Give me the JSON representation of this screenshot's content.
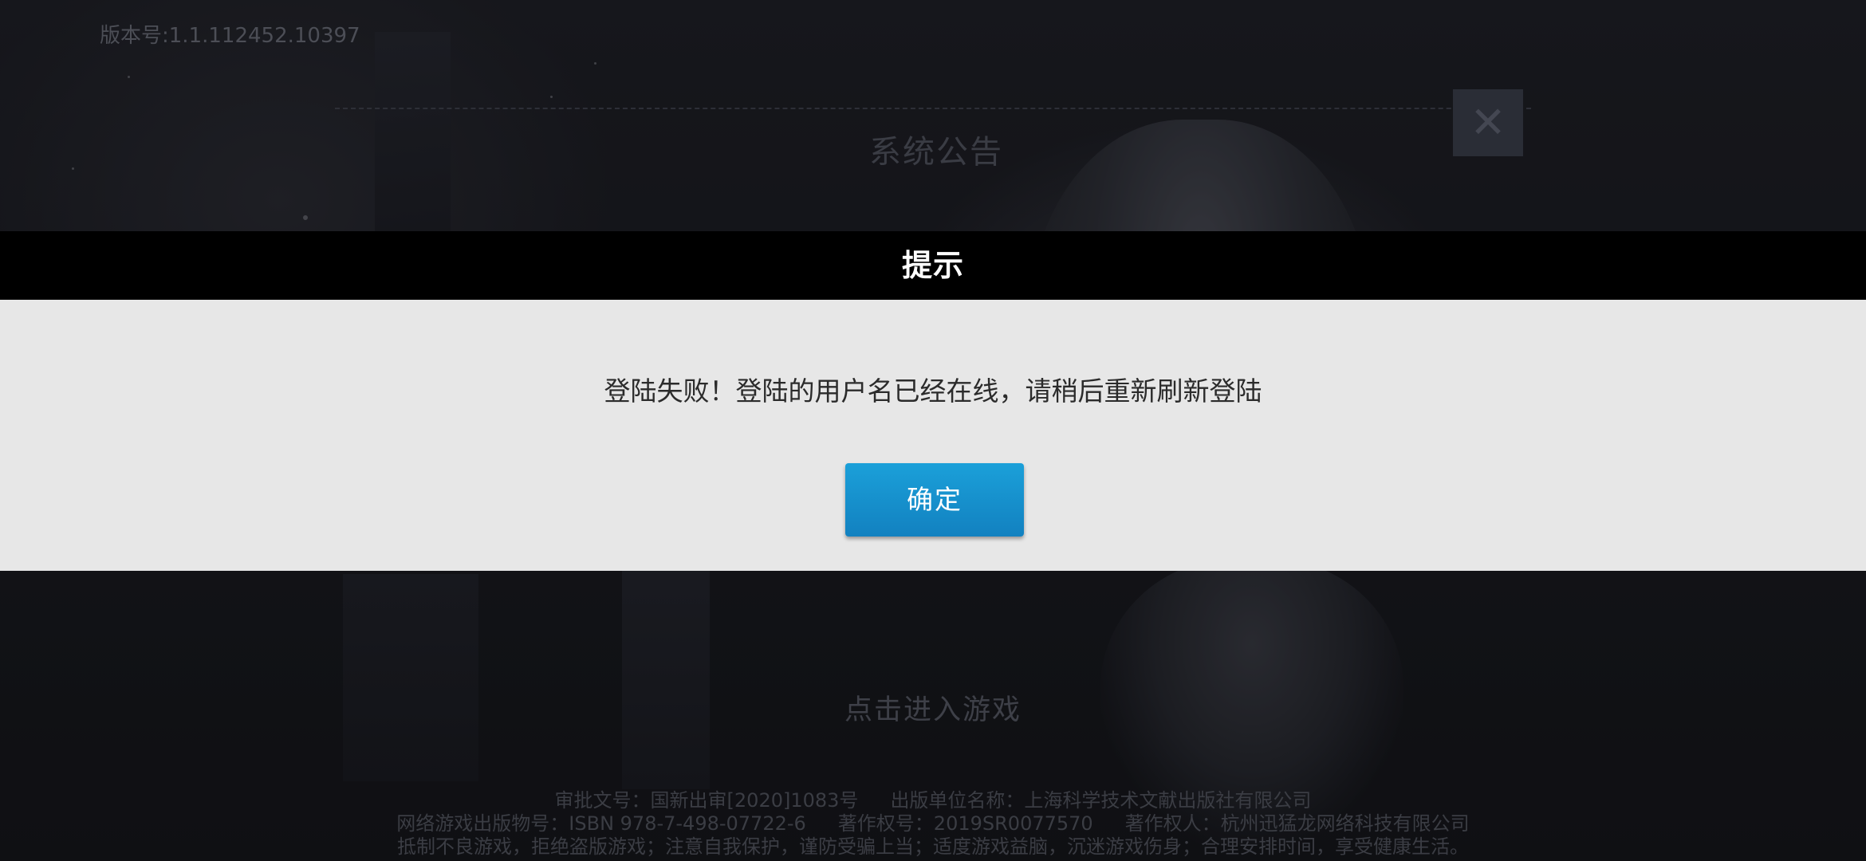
{
  "background": {
    "version_text": "版本号:1.1.112452.10397",
    "notice_title": "系统公告",
    "notice_close_glyph": "✕",
    "enter_game_text": "点击进入游戏",
    "footer": {
      "approval": "审批文号：国新出审[2020]1083号",
      "publisher": "出版单位名称：上海科学技术文献出版社有限公司",
      "isbn": "网络游戏出版物号：ISBN 978-7-498-07722-6",
      "copyright_no": "著作权号：2019SR0077570",
      "copyright_owner": "著作权人：杭州迅猛龙网络科技有限公司",
      "health_notice": "抵制不良游戏，拒绝盗版游戏；注意自我保护，谨防受骗上当；适度游戏益脑，沉迷游戏伤身；合理安排时间，享受健康生活。"
    }
  },
  "dialog": {
    "title": "提示",
    "message": "登陆失败！登陆的用户名已经在线，请稍后重新刷新登陆",
    "confirm_label": "确定"
  },
  "colors": {
    "header_bg": "#000000",
    "body_bg": "#e7e7e7",
    "button_bg": "#1592cf"
  }
}
